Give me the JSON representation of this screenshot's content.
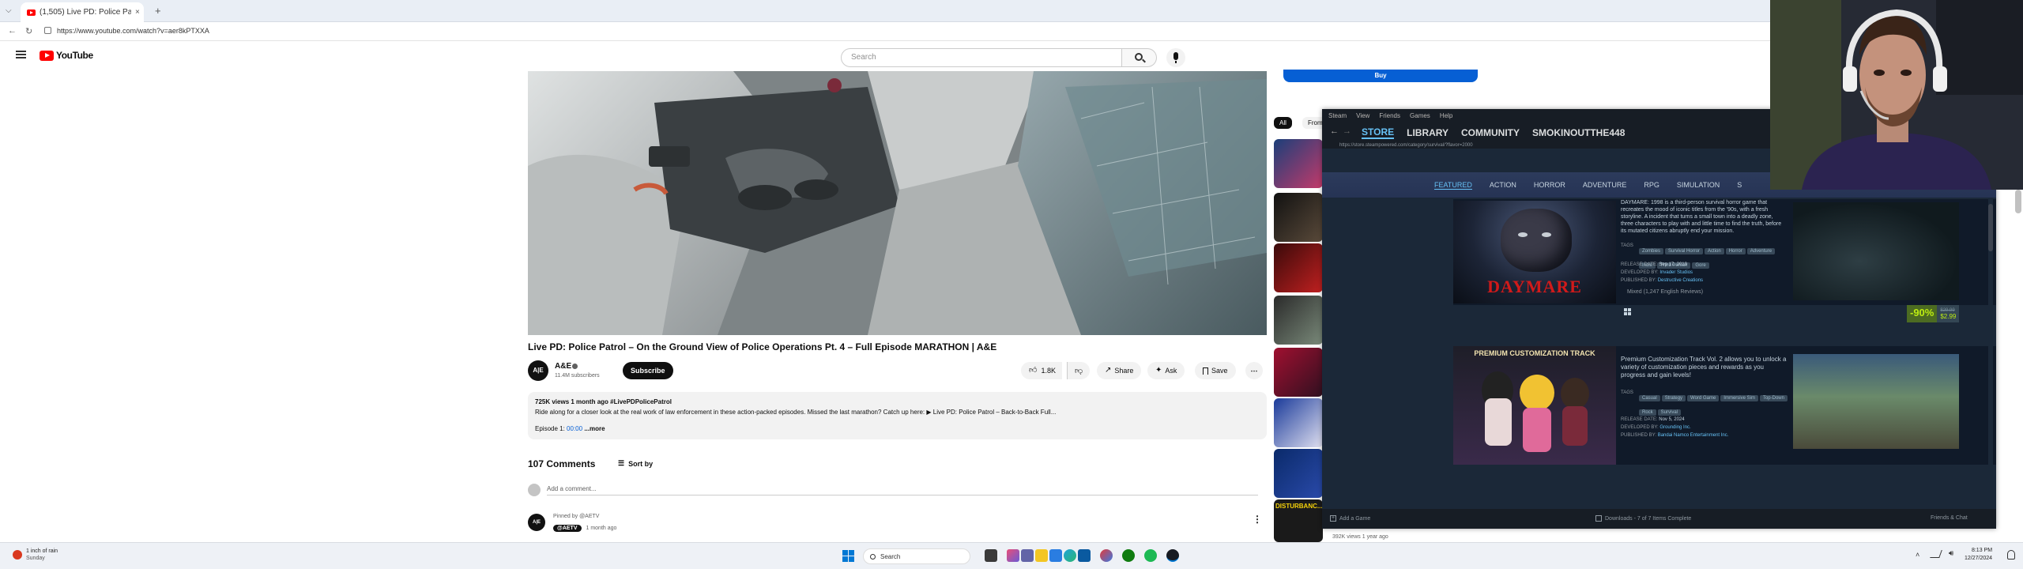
{
  "browser": {
    "tab_title": "(1,505) Live PD: Police Patrol - ...",
    "url": "https://www.youtube.com/watch?v=aer8kPTXXA"
  },
  "youtube": {
    "logo_text": "YouTube",
    "search_placeholder": "Search",
    "video_title": "Live PD: Police Patrol – On the Ground View of Police Operations Pt. 4 – Full Episode MARATHON | A&E",
    "channel_name": "A&E",
    "subscribers": "11.4M subscribers",
    "subscribe_label": "Subscribe",
    "likes": "1.8K",
    "share_label": "Share",
    "ask_label": "Ask",
    "save_label": "Save",
    "desc_meta": "725K views  1 month ago  #LivePDPolicePatrol",
    "desc_text": "Ride along for a closer look at the real work of law enforcement in these action-packed episodes. Missed the last marathon? Catch up here:  ▶ Live PD: Police Patrol – Back-to-Back Full...",
    "desc_episode": "Episode 1:",
    "desc_episode_time": "00:00",
    "desc_more": "...more",
    "comments_count": "107 Comments",
    "sort_by": "Sort by",
    "add_comment": "Add a comment...",
    "pinned_by": "Pinned by @AETV",
    "comment_author": "@AETV",
    "comment_time": "1 month ago",
    "buy_label": "Buy",
    "chip_all": "All",
    "chip_from": "From",
    "side_label": "DISTURBANC...",
    "side_views": "392K views  1 year ago"
  },
  "steam": {
    "menu": [
      "Steam",
      "View",
      "Friends",
      "Games",
      "Help"
    ],
    "nav": [
      "STORE",
      "LIBRARY",
      "COMMUNITY",
      "SMOKINOUTTHE448"
    ],
    "url": "https://store.steampowered.com/category/survival/?flavor=2000",
    "categories": [
      "FEATURED",
      "ACTION",
      "HORROR",
      "ADVENTURE",
      "RPG",
      "SIMULATION",
      "S"
    ],
    "game1": {
      "cover_title": "DAYMARE",
      "description": "DAYMARE: 1998 is a third-person survival horror game that recreates the mood of iconic titles from the '90s, with a fresh storyline. A incident that turns a small town into a deadly zone, three characters to play with and little time to find the truth, before its mutated citizens abruptly end your mission.",
      "tags_label": "TAGS",
      "tags": [
        "Zombies",
        "Survival Horror",
        "Action",
        "Horror",
        "Adventure",
        "Indie",
        "Third Person",
        "Gore"
      ],
      "release_label": "RELEASE DATE:",
      "release": "Sep 17, 2019",
      "dev_label": "DEVELOPED BY:",
      "developer": "Invader Studios",
      "pub_label": "PUBLISHED BY:",
      "publisher": "Destructive Creations",
      "review": "Mixed (1,247 English Reviews)",
      "discount": "-90%",
      "old_price": "$29.99",
      "price": "$2.99"
    },
    "game2": {
      "cover_title": "PREMIUM CUSTOMIZATION TRACK",
      "description": "Premium Customization Track Vol. 2 allows you to unlock a variety of customization pieces and rewards as you progress and gain levels!",
      "tags_label": "TAGS",
      "tags": [
        "Casual",
        "Strategy",
        "Word Game",
        "Immersive Sim",
        "Top-Down",
        "Rock",
        "Survival"
      ],
      "release_label": "RELEASE DATE:",
      "release": "Nov 5, 2024",
      "dev_label": "DEVELOPED BY:",
      "developer": "Grounding Inc.",
      "pub_label": "PUBLISHED BY:",
      "publisher": "Bandai Namco Entertainment Inc."
    },
    "add_game": "Add a Game",
    "downloads": "Downloads - 7 of 7 Items Complete",
    "friends_chat": "Friends & Chat"
  },
  "taskbar": {
    "weather_line1": "1 inch of rain",
    "weather_line2": "Sunday",
    "search_label": "Search",
    "time": "8:13 PM",
    "date": "12/27/2024"
  },
  "colors": {
    "yt_red": "#ff0000",
    "steam_bg": "#1b2838",
    "steam_accent": "#66c0f4",
    "discount_green": "#4c6b22",
    "price_green": "#beee11"
  }
}
